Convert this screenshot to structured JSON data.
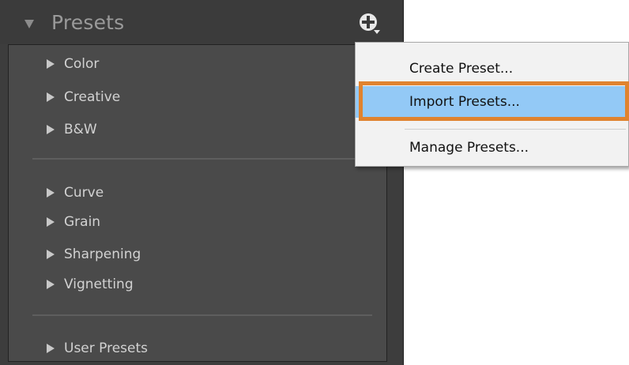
{
  "panel": {
    "title": "Presets",
    "add_icon": "plus-dropdown-icon",
    "groups": [
      {
        "items": [
          "Color",
          "Creative",
          "B&W"
        ]
      },
      {
        "items": [
          "Curve",
          "Grain",
          "Sharpening",
          "Vignetting"
        ]
      },
      {
        "items": [
          "User Presets"
        ]
      }
    ]
  },
  "context_menu": {
    "items": [
      "Create Preset...",
      "Import Presets...",
      "Manage Presets..."
    ],
    "highlighted_index": 1
  },
  "colors": {
    "panel_bg": "#3d3d3d",
    "list_bg": "#4a4a4a",
    "menu_bg": "#f2f2f2",
    "menu_highlight": "#93c9f6",
    "focus_outline": "#e0832f"
  }
}
